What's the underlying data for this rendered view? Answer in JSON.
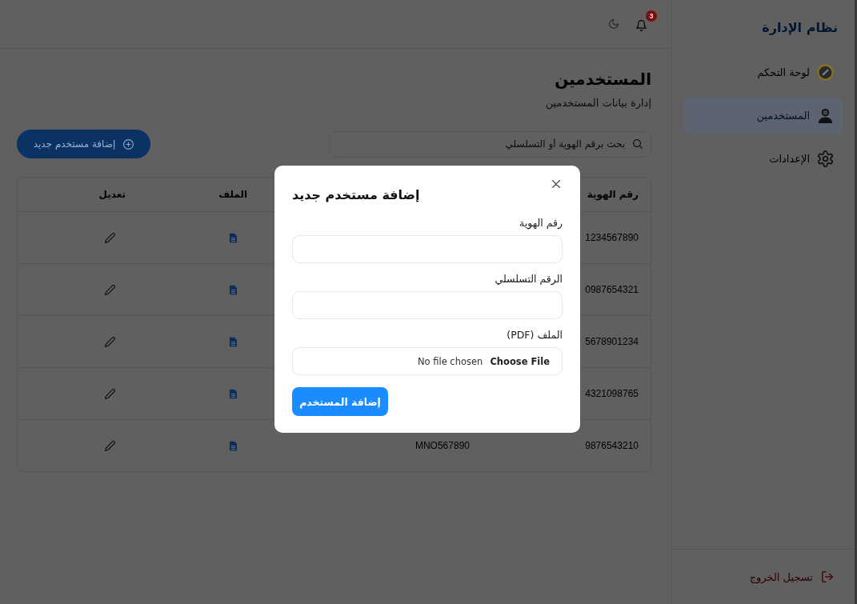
{
  "sidebar": {
    "title": "نظام الإدارة",
    "items": [
      {
        "label": "لوحة التحكم",
        "selected": false
      },
      {
        "label": "المستخدمين",
        "selected": true
      },
      {
        "label": "الإعدادات",
        "selected": false
      }
    ],
    "logout": "تسجيل الخروج"
  },
  "topbar": {
    "notification_count": "3"
  },
  "page": {
    "title": "المستخدمين",
    "subtitle": "إدارة بيانات المستخدمين"
  },
  "search": {
    "placeholder": "بحث برقم الهوية أو التسلسلي"
  },
  "add_button": "إضافة مستخدم جديد",
  "table": {
    "headers": {
      "id_number": "رقم الهوية",
      "file": "الملف",
      "edit": "تعديل"
    },
    "rows": [
      {
        "id_number": "1234567890"
      },
      {
        "id_number": "0987654321"
      },
      {
        "id_number": "5678901234"
      },
      {
        "id_number": "4321098765"
      },
      {
        "id_number": "9876543210",
        "column_2": "MNO567890"
      }
    ]
  },
  "dialog": {
    "title": "إضافة مستخدم جديد",
    "fields": [
      {
        "kind": "text",
        "label": "رقم الهوية"
      },
      {
        "kind": "text",
        "label": "الرقم التسلسلي"
      },
      {
        "kind": "file",
        "label": "الملف (PDF)",
        "button": "Choose File",
        "status": "No file chosen"
      }
    ],
    "submit": "إضافة المستخدم"
  }
}
